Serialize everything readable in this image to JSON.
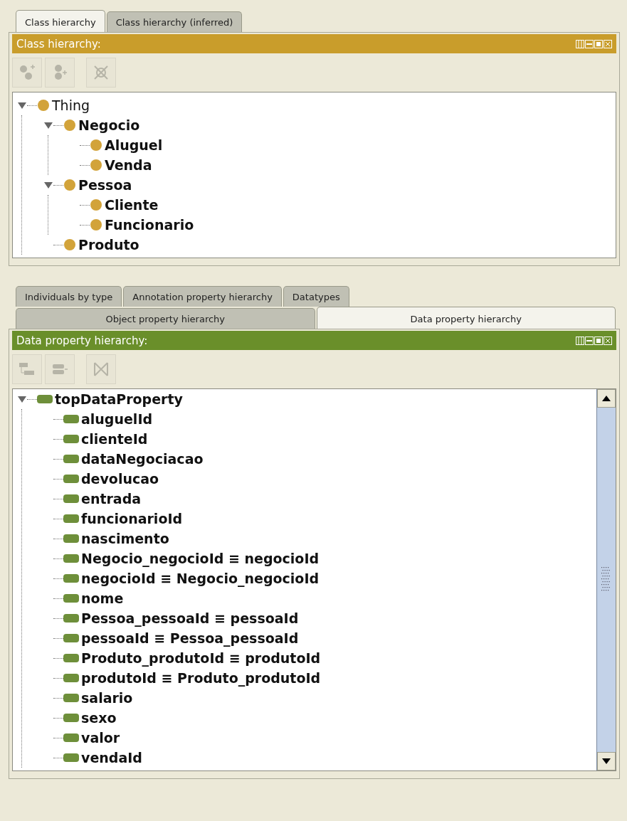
{
  "class_panel": {
    "tabs": [
      {
        "label": "Class hierarchy",
        "selected": true
      },
      {
        "label": "Class hierarchy (inferred)",
        "selected": false
      }
    ],
    "title": "Class hierarchy:",
    "toolbar": [
      {
        "kind": "add-subclass",
        "disabled": true
      },
      {
        "kind": "add-sibling",
        "disabled": true
      },
      {
        "kind": "delete",
        "disabled": true
      }
    ],
    "tree": [
      {
        "label": "Thing",
        "expanded": true,
        "children": [
          {
            "label": "Negocio",
            "expanded": true,
            "children": [
              {
                "label": "Aluguel"
              },
              {
                "label": "Venda"
              }
            ]
          },
          {
            "label": "Pessoa",
            "expanded": true,
            "children": [
              {
                "label": "Cliente"
              },
              {
                "label": "Funcionario"
              }
            ]
          },
          {
            "label": "Produto"
          }
        ]
      }
    ]
  },
  "property_panel": {
    "tab_rows": [
      [
        {
          "label": "Individuals by type",
          "selected": false
        },
        {
          "label": "Annotation property hierarchy",
          "selected": false
        },
        {
          "label": "Datatypes",
          "selected": false
        }
      ],
      [
        {
          "label": "Object property hierarchy",
          "selected": false
        },
        {
          "label": "Data property hierarchy",
          "selected": true
        }
      ]
    ],
    "title": "Data property hierarchy:",
    "toolbar": [
      {
        "kind": "add-subproperty",
        "disabled": true
      },
      {
        "kind": "add-sibling-property",
        "disabled": true
      },
      {
        "kind": "delete-property",
        "disabled": true
      }
    ],
    "tree": [
      {
        "label": "topDataProperty",
        "expanded": true,
        "children": [
          {
            "label": "aluguelId"
          },
          {
            "label": "clienteId"
          },
          {
            "label": "dataNegociacao"
          },
          {
            "label": "devolucao"
          },
          {
            "label": "entrada"
          },
          {
            "label": "funcionarioId"
          },
          {
            "label": "nascimento"
          },
          {
            "label": "Negocio_negocioId ≡ negocioId"
          },
          {
            "label": "negocioId ≡ Negocio_negocioId"
          },
          {
            "label": "nome"
          },
          {
            "label": "Pessoa_pessoaId ≡ pessoaId"
          },
          {
            "label": "pessoaId ≡ Pessoa_pessoaId"
          },
          {
            "label": "Produto_produtoId ≡ produtoId"
          },
          {
            "label": "produtoId ≡ Produto_produtoId"
          },
          {
            "label": "salario"
          },
          {
            "label": "sexo"
          },
          {
            "label": "valor"
          },
          {
            "label": "vendaId"
          }
        ]
      }
    ]
  }
}
